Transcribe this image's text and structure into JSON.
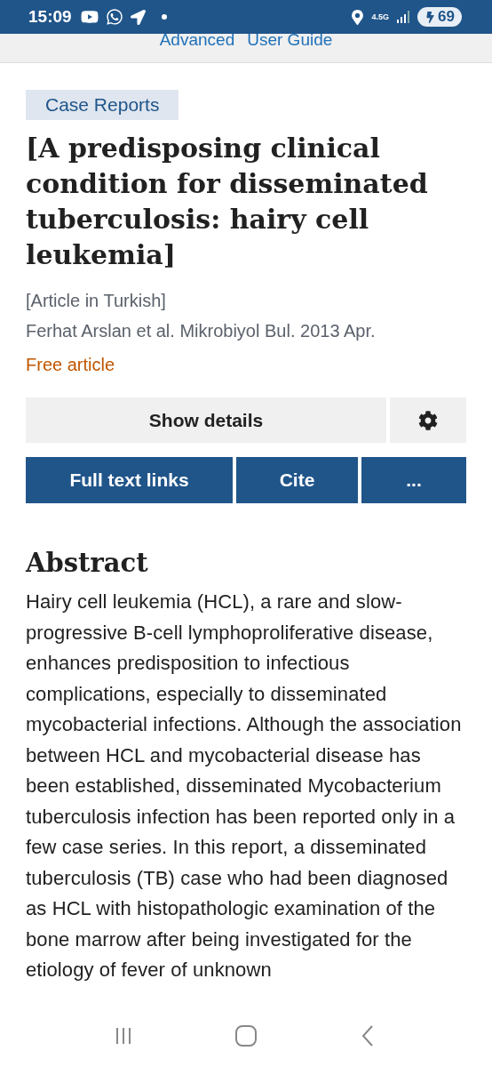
{
  "status_bar": {
    "time": "15:09",
    "network": "4.5G",
    "battery": "69"
  },
  "top_links": [
    "Advanced",
    "User Guide"
  ],
  "article": {
    "type_tag": "Case Reports",
    "title": "[A predisposing clinical condition for disseminated tuberculosis: hairy cell leukemia]",
    "language_note": "[Article in Turkish]",
    "citation": "Ferhat Arslan et al. Mikrobiyol Bul. 2013 Apr.",
    "access": "Free article"
  },
  "details_button": "Show details",
  "action_buttons": [
    "Full text links",
    "Cite",
    "..."
  ],
  "abstract": {
    "heading": "Abstract",
    "text": "Hairy cell leukemia (HCL), a rare and slow-progressive B-cell lymphoproliferative disease, enhances predisposition to infectious complications, especially to disseminated mycobacterial infections. Although the association between HCL and mycobacterial disease has been established, disseminated Mycobacterium tuberculosis infection has been reported only in a few case series. In this report, a disseminated tuberculosis (TB) case who had been diagnosed as HCL with histopathologic examination of the bone marrow after being investigated for the etiology of fever of unknown"
  }
}
